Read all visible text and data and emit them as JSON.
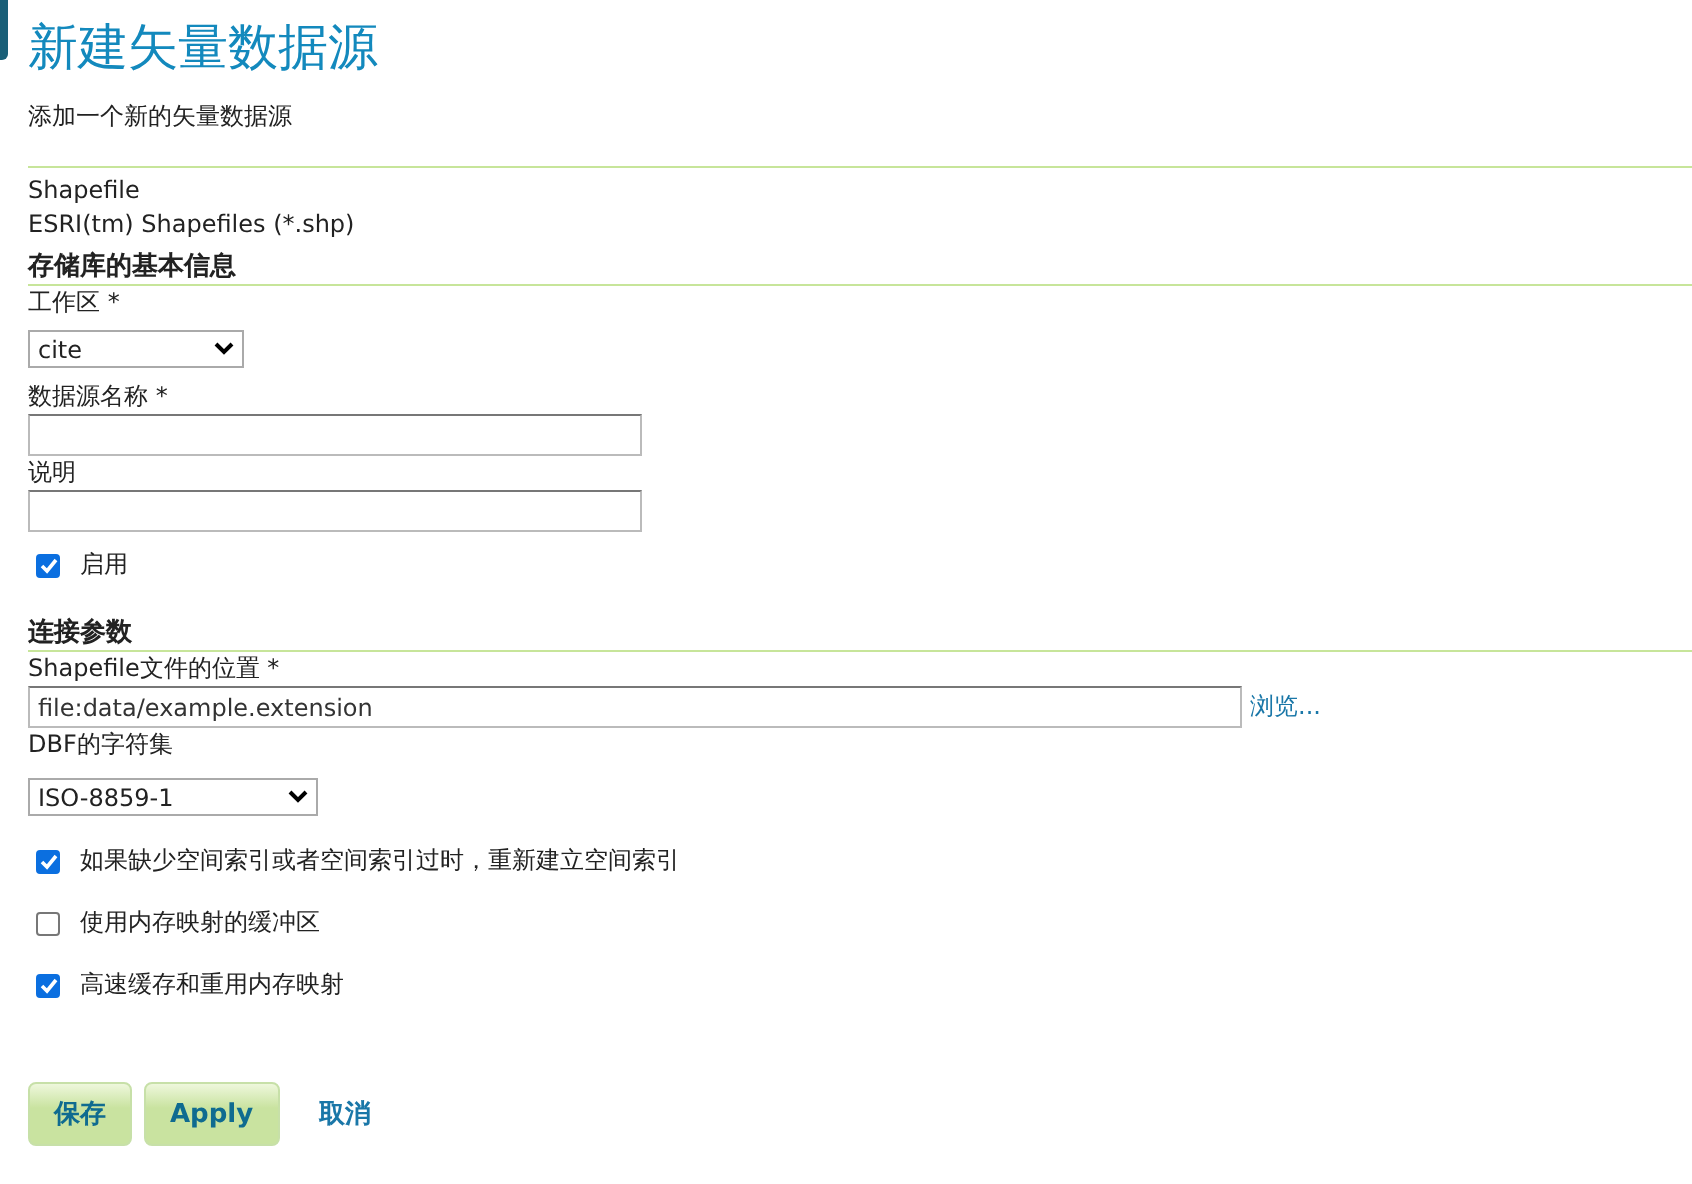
{
  "page": {
    "title": "新建矢量数据源",
    "subtitle": "添加一个新的矢量数据源"
  },
  "store_type": {
    "name": "Shapefile",
    "description": "ESRI(tm) Shapefiles (*.shp)"
  },
  "basic_info": {
    "heading": "存储库的基本信息",
    "workspace": {
      "label": "工作区 *",
      "value": "cite"
    },
    "name": {
      "label": "数据源名称 *"
    },
    "description": {
      "label": "说明"
    },
    "enabled": {
      "label": "启用",
      "checked": true
    }
  },
  "connection": {
    "heading": "连接参数",
    "location": {
      "label": "Shapefile文件的位置 *",
      "value": "file:data/example.extension",
      "browse": "浏览..."
    },
    "charset": {
      "label": "DBF的字符集",
      "value": "ISO-8859-1"
    },
    "options": [
      {
        "label": "如果缺少空间索引或者空间索引过时，重新建立空间索引",
        "checked": true
      },
      {
        "label": "使用内存映射的缓冲区",
        "checked": false
      },
      {
        "label": "高速缓存和重用内存映射",
        "checked": true
      }
    ]
  },
  "actions": [
    {
      "label": "保存",
      "kind": "button"
    },
    {
      "label": "Apply",
      "kind": "button"
    },
    {
      "label": "取消",
      "kind": "link"
    }
  ]
}
